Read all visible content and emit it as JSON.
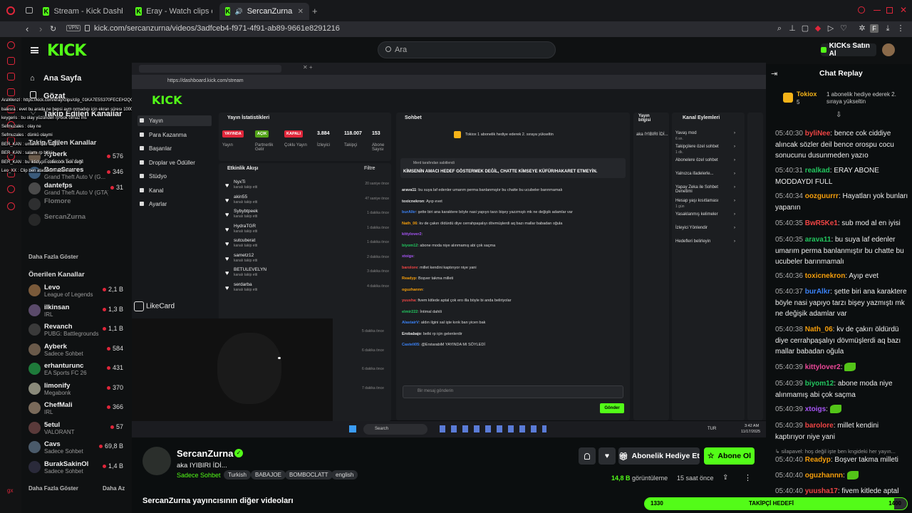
{
  "browser": {
    "tabs": [
      {
        "label": "Stream - Kick Dashboard"
      },
      {
        "label": "Eray - Watch clips on Kic"
      },
      {
        "label": "SercanZurna - Watch"
      }
    ],
    "url": "kick.com/sercanzurna/videos/3adfceb4-f971-4f91-ab89-9661e8291216",
    "vpn": "VPN",
    "profile_initial": "F"
  },
  "header": {
    "logo": "KICK",
    "search_placeholder": "Ara",
    "buy_label": "KICKs Satın Al"
  },
  "sidebar": {
    "nav": [
      {
        "label": "Ana Sayfa"
      },
      {
        "label": "Gözat"
      },
      {
        "label": "Takip Edilen Kanallar"
      }
    ],
    "followed_title": "Takip Edilen Kanallar",
    "followed": [
      {
        "name": "Ayberk",
        "game": "Sadece Sohbet",
        "viewers": "576",
        "color": "#6a5a4a"
      },
      {
        "name": "BoneSaures",
        "game": "Grand Theft Auto V (G...",
        "viewers": "346",
        "color": "#3a5a7a"
      },
      {
        "name": "dantefps",
        "game": "Grand Theft Auto V (GTA)",
        "viewers": "31",
        "color": "#4a4a4a"
      },
      {
        "name": "Flomore",
        "game": "",
        "viewers": "",
        "color": "#555"
      },
      {
        "name": "SercanZurna",
        "game": "",
        "viewers": "",
        "color": "#444"
      }
    ],
    "show_more": "Daha Fazla Göster",
    "recommended_title": "Önerilen Kanallar",
    "recommended": [
      {
        "name": "Levo",
        "game": "League of Legends",
        "viewers": "2,1 B",
        "color": "#7a5a3a"
      },
      {
        "name": "ilkinsan",
        "game": "IRL",
        "viewers": "1,3 B",
        "color": "#5a4a6a"
      },
      {
        "name": "Revanch",
        "game": "PUBG: Battlegrounds",
        "viewers": "1,1 B",
        "color": "#3a3a3a"
      },
      {
        "name": "Ayberk",
        "game": "Sadece Sohbet",
        "viewers": "584",
        "color": "#6a5a4a"
      },
      {
        "name": "erhanturunc",
        "game": "EA Sports FC 26",
        "viewers": "431",
        "color": "#1e7a3a"
      },
      {
        "name": "limonify",
        "game": "Megabonk",
        "viewers": "370",
        "color": "#8a8a7a"
      },
      {
        "name": "ChefMali",
        "game": "IRL",
        "viewers": "366",
        "color": "#7a6a5a"
      },
      {
        "name": "5etul",
        "game": "VALORANT",
        "viewers": "57",
        "color": "#5a3a3a"
      },
      {
        "name": "Cavs",
        "game": "Sadece Sohbet",
        "viewers": "69,8 B",
        "color": "#4a5a6a"
      },
      {
        "name": "BurakSakinOl",
        "game": "Sadece Sohbet",
        "viewers": "1,4 B",
        "color": "#2a2a3a"
      }
    ],
    "show_more2": "Daha Fazla Göster",
    "show_less": "Daha Az"
  },
  "overlay_chat": [
    "AraWenzl : https://kick.com/eray/clips/clip_01KA7E5S370FECEH2QQ11TZ81",
    "balesra : evet bu arada ne bepsi aym nrmadıgı için ekran süresı 1000 mamamööasleb",
    "keygeris : bu olay yüzünden rp bok olmaz ins",
    "Sefmuzales : olay ne",
    "Sefmuzales : dünkü olaymi",
    "BER_KAN : umarım bitir sağlık",
    "BER_KAN : salamı rp bitişi",
    "BER_KAN : bu iktidşçin collecock bok değil",
    "Leo_XX : Clip ben atacaktım adam attı"
  ],
  "dashboard": {
    "url": "https://dashboard.kick.com/stream",
    "logo": "KICK",
    "nav": [
      "Yayın",
      "Para Kazanma",
      "Başarılar",
      "Droplar ve Ödüller",
      "Stüdyo",
      "Kanal",
      "Ayarlar"
    ],
    "stats_title": "Yayın İstatistikleri",
    "stats": [
      {
        "badge": "YAYINDA",
        "label": "Yayın",
        "color": "#e0263a"
      },
      {
        "badge": "AÇIK",
        "label": "Partnerlik Gelir",
        "color": "#53a318"
      },
      {
        "badge": "KAPALI",
        "label": "Çoklu Yayın",
        "color": "#e0263a"
      },
      {
        "value": "3.884",
        "label": "İzleyici"
      },
      {
        "value": "118.007",
        "label": "Takipçi"
      },
      {
        "value": "153",
        "label": "Abone Sayısı"
      }
    ],
    "activity_title": "Etkinlik Akışı",
    "filter": "Filtre",
    "events": [
      {
        "name": "NyxTi",
        "sub": "kanalı takip etti",
        "time": "20 saniye önce"
      },
      {
        "name": "akin55",
        "sub": "kanalı takip etti",
        "time": "47 saniye önce"
      },
      {
        "name": "Sybybtpeek",
        "sub": "kanalı takip etti",
        "time": "1 dakika önce"
      },
      {
        "name": "HydraTGR",
        "sub": "kanalı takip etti",
        "time": "1 dakika önce"
      },
      {
        "name": "sutcuberat",
        "sub": "kanalı takip etti",
        "time": "1 dakika önce"
      },
      {
        "name": "sametz12",
        "sub": "kanalı takip etti",
        "time": "2 dakika önce"
      },
      {
        "name": "BETULEVELYN",
        "sub": "kanalı takip etti",
        "time": "3 dakika önce"
      },
      {
        "name": "serdarba",
        "sub": "kanalı takip etti",
        "time": "4 dakika önce"
      }
    ],
    "event_times_extra": [
      "5 dakika önce",
      "6 dakika önce",
      "6 dakika önce",
      "7 dakika önce"
    ],
    "chat_title": "Sohbet",
    "chat_gift": "Tokiox  1 abonelik hediye ederek 2. sıraya yükseltin",
    "pinned_by": "Merd tarafından sabitlendi",
    "pinned": "KİMSENİN AMACI HEDEF GÖSTERMEK DEĞİL, CHATTE KİMSEYE KÜFÜR/HAKARET ETMEYİN.",
    "chat_lines": [
      {
        "user": "arava11",
        "text": "bu suya laf edenler umarım perma banlanmıştır bu chatte bu ucubeler barınmamalı",
        "color": "#e7e7e7"
      },
      {
        "user": "toxicnekron",
        "text": "Ayıp evet",
        "color": "#e7e7e7"
      },
      {
        "user": "burAlkr",
        "text": "şette biri ana karaktere böyle nasi yapıyo tarzı bişey yazzmıştı mk ne değişik adamlar var",
        "color": "#3b82f6"
      },
      {
        "user": "Nath_06",
        "text": "kv de çakırı öldürdü diye cerrahpaşalıyı dövmüşlerdi aq bazı mallar babadan oğula",
        "color": "#f59e0b"
      },
      {
        "user": "kittylover2",
        "text": "",
        "color": "#a855f7"
      },
      {
        "user": "biyom12",
        "text": "abone moda niye alınmamış abi çok saçma",
        "color": "#22c55e"
      },
      {
        "user": "xtoigs",
        "text": "",
        "color": "#a855f7"
      },
      {
        "user": "barolore",
        "text": "millet kendini kaptırıyor niye yani",
        "color": "#ef4444"
      },
      {
        "user": "Readyp",
        "text": "Boşver takma milleti",
        "color": "#f59e0b"
      },
      {
        "user": "oguzhannn",
        "text": "",
        "color": "#f59e0b"
      },
      {
        "user": "yuusha",
        "text": "fivem kitlede aptal çok ero illa böyle bi anda beliriyolar",
        "color": "#ef4444"
      },
      {
        "user": "elmir222",
        "text": "İntimal dahili",
        "color": "#22c55e"
      },
      {
        "user": "AlastairV",
        "text": "aldın ilgini sal işte kırık ban yicen bak",
        "color": "#3b82f6"
      },
      {
        "user": "Erobabajo",
        "text": "belki rp için gelenlerdir",
        "color": "#e7e7e7"
      },
      {
        "user": "Casteli05",
        "text": "@ErstarabiM YAYINDA MI SÖYLEDİ",
        "color": "#3b82f6"
      }
    ],
    "chat_input_placeholder": "Bir mesaj gönderin",
    "send_label": "Gönder",
    "stream_info_title": "Yayın bilgisi",
    "stream_info_name": "aka IYIBIRI İDİ...",
    "channel_actions_title": "Kanal Eylemleri",
    "channel_actions": [
      {
        "label": "Yavaş mod",
        "sub": "6 sn."
      },
      {
        "label": "Takipçilere özel sohbet",
        "sub": "1 dk."
      },
      {
        "label": "Abonelere özel sohbet",
        "sub": ""
      },
      {
        "label": "Yalnızca ifadelerle...",
        "sub": ""
      },
      {
        "label": "Yapay Zeka ile Sohbet Denetimi",
        "sub": ""
      },
      {
        "label": "Hesap yaşı kısıtlaması",
        "sub": "1 gün"
      },
      {
        "label": "Yasaklanmış kelimeler",
        "sub": ""
      },
      {
        "label": "İzleyici Yönlendir",
        "sub": ""
      },
      {
        "label": "Hedefleri belirleyin",
        "sub": ""
      }
    ],
    "likecard": "LikeCard",
    "taskbar_search": "Search",
    "taskbar_lang": "TUR",
    "taskbar_time": "3:42 AM",
    "taskbar_date": "11/17/2025"
  },
  "channel": {
    "name": "SercanZurna",
    "title": "aka IYIBIRI İDİ...",
    "category": "Sadece Sohbet",
    "tags": [
      "Turkish",
      "BABAJOE",
      "BOMBOCLATT",
      "english"
    ],
    "gift_sub_label": "Abonelik Hediye Et",
    "subscribe_label": "Abone Ol",
    "views": "14,8 B",
    "views_label": "görüntüleme",
    "time_ago": "15 saat önce",
    "more_videos": "SercanZurna yayıncısının diğer videoları"
  },
  "chat_replay": {
    "title": "Chat Replay",
    "gift_user": "Tokiox",
    "gift_count": "5",
    "gift_text": "1 abonelik hediye ederek 2. sıraya yükseltin",
    "messages": [
      {
        "time": "05:40:30",
        "user": "byliNee",
        "text": "bence cok ciddiye alıncak sözler deil bence orospu cocu sonucunu dusunmeden yazıo",
        "color": "#ef4444"
      },
      {
        "time": "05:40:31",
        "user": "realkad",
        "text": "ERAY ABONE MODDAYDI FULL",
        "color": "#22c55e"
      },
      {
        "time": "05:40:34",
        "user": "oozguurrr",
        "text": "Hayatları yok bunları yapanın",
        "color": "#f59e0b"
      },
      {
        "time": "05:40:35",
        "user": "BwR5Ke1",
        "text": "sub mod al en iyisi",
        "color": "#ef4444"
      },
      {
        "time": "05:40:35",
        "user": "arava11",
        "text": "bu suya laf edenler umarım perma banlanmıştır bu chatte bu ucubeler barınmamalı",
        "color": "#22c55e"
      },
      {
        "time": "05:40:36",
        "user": "toxicnekron",
        "text": "Ayıp evet",
        "color": "#f59e0b"
      },
      {
        "time": "05:40:37",
        "user": "burAlkr",
        "text": "şette biri ana karaktere böyle nasi yapıyo tarzı bişey yazmıştı mk ne değişik adamlar var",
        "color": "#3b82f6"
      },
      {
        "time": "05:40:38",
        "user": "Nath_06",
        "text": "kv de çakırı öldürdü diye cerrahpaşalıyı dövmüşlerdi aq bazı mallar babadan oğula",
        "color": "#f59e0b"
      },
      {
        "time": "05:40:39",
        "user": "kittylover2",
        "text": "",
        "color": "#ec4899"
      },
      {
        "time": "05:40:39",
        "user": "biyom12",
        "text": "abone moda niye alınmamış abi çok saçma",
        "color": "#22c55e"
      },
      {
        "time": "05:40:39",
        "user": "xtoigs",
        "text": "",
        "color": "#a855f7"
      },
      {
        "time": "05:40:39",
        "user": "barolore",
        "text": "millet kendini kaptırıyor niye yani",
        "color": "#ef4444"
      },
      {
        "time": "",
        "user": "",
        "text": "↳ silapavel: hoş değil işte ben kngideki her yayın...",
        "color": "#999"
      },
      {
        "time": "05:40:40",
        "user": "Readyp",
        "text": "Boşver takma milleti",
        "color": "#f59e0b"
      },
      {
        "time": "05:40:40",
        "user": "oguzhannn",
        "text": "",
        "color": "#f59e0b"
      },
      {
        "time": "05:40:40",
        "user": "yuusha17",
        "text": "fivem kitlede aptal",
        "color": "#ef4444"
      }
    ],
    "goal_label": "TAKİPÇİ HEDEFİ",
    "goal_current": "1330",
    "goal_target": "1400",
    "goal_progress": 0.95
  }
}
